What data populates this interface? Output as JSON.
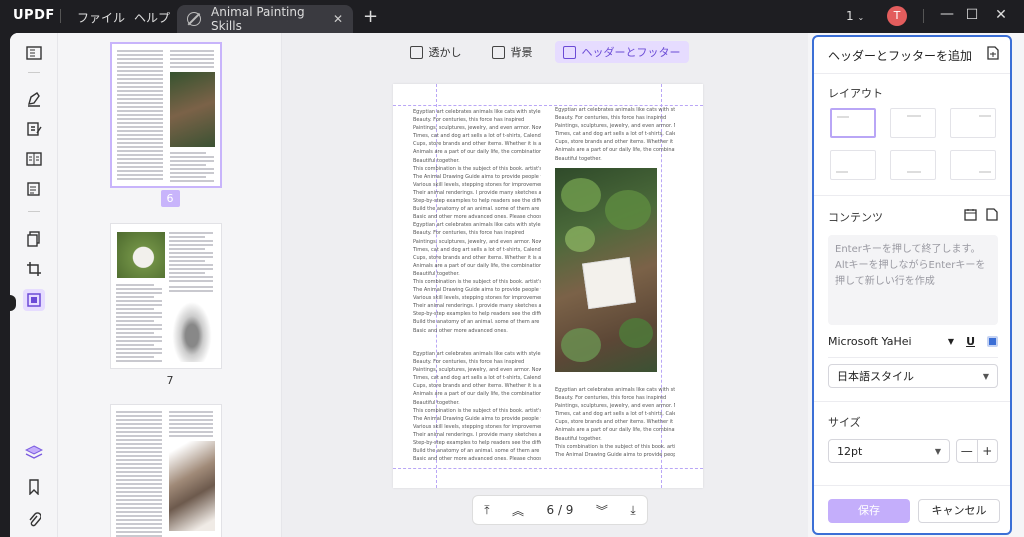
{
  "app": {
    "logo_a": "UPDF",
    "menu": [
      "ファイル",
      "ヘルプ"
    ],
    "tab_title": "Animal Painting Skills",
    "tab_close": "✕",
    "new_tab": "+",
    "page_count": "1",
    "avatar": "T"
  },
  "window": {
    "minimize": "—",
    "maximize": "☐",
    "close": "✕"
  },
  "thumbnails": {
    "pages": [
      "6",
      "7"
    ]
  },
  "toolbar": {
    "watermark": "透かし",
    "background": "背景",
    "header_footer": "ヘッダーとフッター"
  },
  "page_text": {
    "col1": [
      "Egyptian art celebrates animals like cats with style and style",
      "Beauty. For centuries, this force has inspired",
      "Paintings, sculptures, jewelry, and even armor. Nowadays",
      "Times, cat and dog art sells a lot of t-shirts, Calendars, Coffee",
      "Cups, store brands and other items. Whether it is art or domestic",
      "Animals are a part of our daily life, the combination of the two",
      "Beautiful together.",
      "This combination is the subject of this book. artist's",
      "The Animal Drawing Guide aims to provide people with",
      "Various skill levels, stepping stones for improvement",
      "Their animal renderings. I provide many sketches and",
      "Step-by-step examples to help readers see the different ways",
      "Build the anatomy of an animal. some of them are quite",
      "Basic and other more advanced ones. Please choose",
      "Egyptian art celebrates animals like cats with style and style",
      "Beauty. For centuries, this force has inspired",
      "Paintings, sculptures, jewelry, and even armor. Nowadays",
      "Times, cat and dog art sells a lot of t-shirts, Calendars, Coffee",
      "Cups, store brands and other items. Whether it is art or domestic",
      "Animals are a part of our daily life, the combination of the two",
      "Beautiful together.",
      "This combination is the subject of this book. artist's",
      "The Animal Drawing Guide aims to provide people with",
      "Various skill levels, stepping stones for improvement",
      "Their animal renderings. I provide many sketches and",
      "Step-by-step examples to help readers see the different ways",
      "Build the anatomy of an animal. some of them are quite",
      "Basic and other more advanced ones."
    ],
    "col1b": [
      "Egyptian art celebrates animals like cats with style and style",
      "Beauty. For centuries, this force has inspired",
      "Paintings, sculptures, jewelry, and even armor. Nowadays",
      "Times, cat and dog art sells a lot of t-shirts, Calendars, Coffee",
      "Cups, store brands and other items. Whether it is art or domestic",
      "Animals are a part of our daily life, the combination of the two",
      "Beautiful together.",
      "This combination is the subject of this book. artist's",
      "The Animal Drawing Guide aims to provide people with",
      "Various skill levels, stepping stones for improvement",
      "Their animal renderings. I provide many sketches and",
      "Step-by-step examples to help readers see the different ways",
      "Build the anatomy of an animal. some of them are quite",
      "Basic and other more advanced ones. Please choose"
    ],
    "col2top": [
      "Egyptian art celebrates animals like cats with style and style",
      "Beauty. For centuries, this force has inspired",
      "Paintings, sculptures, jewelry, and even armor. Nowadays",
      "Times, cat and dog art sells a lot of t-shirts, Calendars, Coffee",
      "Cups, store brands and other items. Whether it is art or domestic",
      "Animals are a part of our daily life, the combination of the two",
      "Beautiful together."
    ],
    "col2bottom": [
      "Egyptian art celebrates animals like cats with style and style",
      "Beauty. For centuries, this force has inspired",
      "Paintings, sculptures, jewelry, and even armor. Nowadays",
      "Times, cat and dog art sells a lot of t-shirts, Calendars, Coffee",
      "Cups, store brands and other items. Whether it is art or domestic",
      "Animals are a part of our daily life, the combination of the two",
      "Beautiful together.",
      "This combination is the subject of this book. artist's",
      "The Animal Drawing Guide aims to provide people with"
    ]
  },
  "pager": {
    "current": "6 / 9"
  },
  "panel": {
    "title": "ヘッダーとフッターを追加",
    "layout_label": "レイアウト",
    "content_label": "コンテンツ",
    "placeholder": "Enterキーを押して終了します。Altキーを押しながらEnterキーを押して新しい行を作成",
    "font": "Microsoft YaHei",
    "style": "日本語スタイル",
    "size_label": "サイズ",
    "size_value": "12pt",
    "minus": "—",
    "plus": "+",
    "save": "保存",
    "cancel": "キャンセル",
    "underline_icon": "U"
  }
}
